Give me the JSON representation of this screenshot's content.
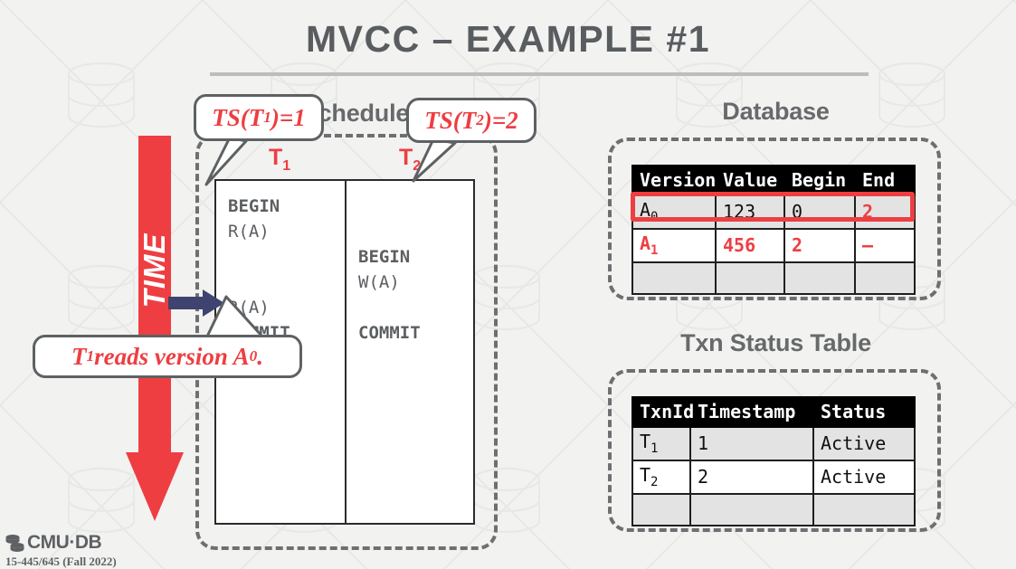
{
  "slide": {
    "title": "MVCC – EXAMPLE #1",
    "accent_red": "#EE3E41",
    "heading_gray": "#67696B",
    "navy": "#3E4370"
  },
  "schedule": {
    "heading": "Schedule",
    "columns": [
      {
        "label": "T",
        "sub": "1",
        "ops": [
          "BEGIN",
          "R(A)",
          "",
          "",
          "R(A)",
          "COMMIT"
        ]
      },
      {
        "label": "T",
        "sub": "2",
        "ops": [
          "",
          "",
          "BEGIN",
          "W(A)",
          "",
          "COMMIT"
        ]
      }
    ],
    "time_label": "TIME"
  },
  "callouts": [
    {
      "name": "ts-t1",
      "text": "TS(T",
      "sub": "1",
      "tail": ")=1"
    },
    {
      "name": "ts-t2",
      "text": "TS(T",
      "sub": "2",
      "tail": ")=2"
    },
    {
      "name": "t1-reads",
      "text": "T",
      "sub": "1",
      "tail": " reads version A",
      "sub2": "0",
      "tail2": "."
    }
  ],
  "database": {
    "heading": "Database",
    "headers": [
      "Version",
      "Value",
      "Begin",
      "End"
    ],
    "rows": [
      {
        "style": "shaded",
        "highlighted": true,
        "cells": [
          {
            "text": "A",
            "sub": "0",
            "red": false
          },
          {
            "text": "123",
            "red": false
          },
          {
            "text": "0",
            "red": false
          },
          {
            "text": "2",
            "red": true
          }
        ]
      },
      {
        "style": "plain",
        "highlighted": false,
        "cells": [
          {
            "text": "A",
            "sub": "1",
            "red": true
          },
          {
            "text": "456",
            "red": true
          },
          {
            "text": "2",
            "red": true
          },
          {
            "text": "–",
            "red": true
          }
        ]
      },
      {
        "style": "shaded",
        "highlighted": false,
        "cells": [
          {
            "text": "",
            "red": false
          },
          {
            "text": "",
            "red": false
          },
          {
            "text": "",
            "red": false
          },
          {
            "text": "",
            "red": false
          }
        ]
      }
    ]
  },
  "txn_status": {
    "heading": "Txn Status Table",
    "headers": [
      "TxnId",
      "Timestamp",
      "Status"
    ],
    "rows": [
      {
        "style": "shaded",
        "cells": [
          {
            "text": "T",
            "sub": "1"
          },
          {
            "text": "1"
          },
          {
            "text": "Active"
          }
        ]
      },
      {
        "style": "plain",
        "cells": [
          {
            "text": "T",
            "sub": "2"
          },
          {
            "text": "2"
          },
          {
            "text": "Active"
          }
        ]
      },
      {
        "style": "shaded",
        "cells": [
          {
            "text": ""
          },
          {
            "text": ""
          },
          {
            "text": ""
          }
        ]
      }
    ]
  },
  "footer": {
    "logo": "CMU·DB",
    "course": "15-445/645 (Fall 2022)"
  }
}
